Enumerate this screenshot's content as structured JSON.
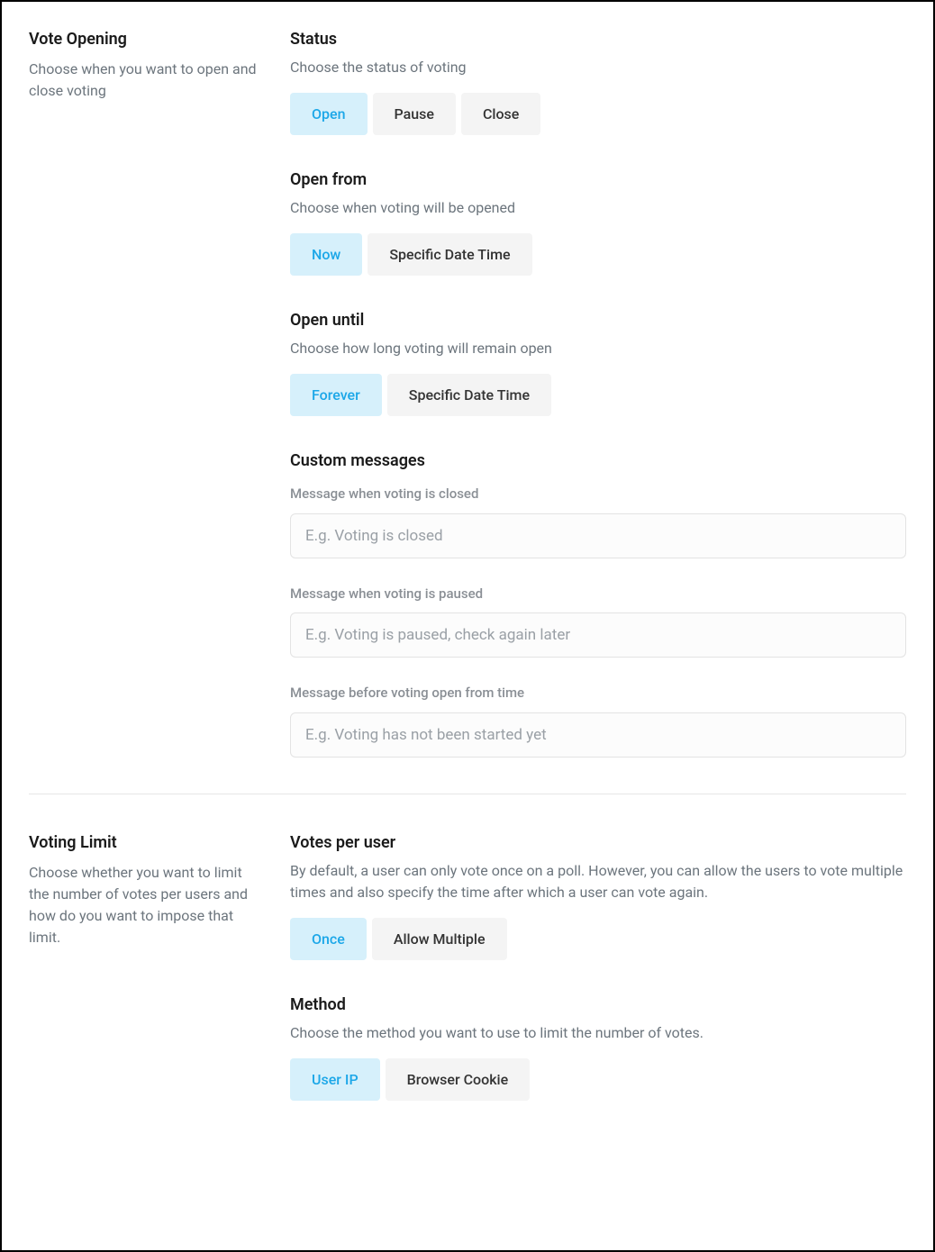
{
  "voteOpening": {
    "title": "Vote Opening",
    "desc": "Choose when you want to open and close voting",
    "status": {
      "title": "Status",
      "desc": "Choose the status of voting",
      "options": {
        "open": "Open",
        "pause": "Pause",
        "close": "Close"
      }
    },
    "openFrom": {
      "title": "Open from",
      "desc": "Choose when voting will be opened",
      "options": {
        "now": "Now",
        "specific": "Specific Date Time"
      }
    },
    "openUntil": {
      "title": "Open until",
      "desc": "Choose how long voting will remain open",
      "options": {
        "forever": "Forever",
        "specific": "Specific Date Time"
      }
    },
    "customMessages": {
      "title": "Custom messages",
      "closed": {
        "label": "Message when voting is closed",
        "placeholder": "E.g. Voting is closed"
      },
      "paused": {
        "label": "Message when voting is paused",
        "placeholder": "E.g. Voting is paused, check again later"
      },
      "before": {
        "label": "Message before voting open from time",
        "placeholder": "E.g. Voting has not been started yet"
      }
    }
  },
  "votingLimit": {
    "title": "Voting Limit",
    "desc": "Choose whether you want to limit the number of votes per users and how do you want to impose that limit.",
    "votesPerUser": {
      "title": "Votes per user",
      "desc": "By default, a user can only vote once on a poll. However, you can allow the users to vote multiple times and also specify the time after which a user can vote again.",
      "options": {
        "once": "Once",
        "multiple": "Allow Multiple"
      }
    },
    "method": {
      "title": "Method",
      "desc": "Choose the method you want to use to limit the number of votes.",
      "options": {
        "ip": "User IP",
        "cookie": "Browser Cookie"
      }
    }
  }
}
